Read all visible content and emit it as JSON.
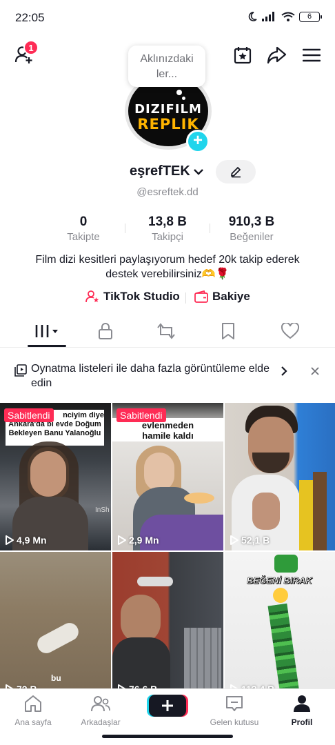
{
  "status_bar": {
    "time": "22:05",
    "battery": "6"
  },
  "profile": {
    "badge_count": "1",
    "note_text": "Aklınızdaki ler...",
    "avatar_line1": "DIZIFILM",
    "avatar_line2": "REPLIK",
    "username": "eşrefTEK",
    "handle": "@esreftek.dd",
    "stats": [
      {
        "value": "0",
        "label": "Takipte"
      },
      {
        "value": "13,8 B",
        "label": "Takipçi"
      },
      {
        "value": "910,3 B",
        "label": "Beğeniler"
      }
    ],
    "bio": "Film dizi kesitleri paylaşıyorum hedef 20k takip ederek destek verebilirsiniz🫶🌹",
    "tiktok_studio": "TikTok Studio",
    "balance": "Bakiye"
  },
  "banner": {
    "text": "Oynatma listeleri ile daha fazla görüntüleme elde edin"
  },
  "videos": [
    {
      "pinned": "Sabitlendi",
      "caption": "Ankara'da bi evde Doğum Bekleyen Banu Yalanoğlu",
      "caption_top": "nciyim diye",
      "views": "4,9 Mn",
      "watermark": "InSh"
    },
    {
      "pinned": "Sabitlendi",
      "caption": "evlenmeden hamile kaldı",
      "views": "2,9 Mn"
    },
    {
      "views": "52,1 B"
    },
    {
      "views": "72 B",
      "caption": "bu"
    },
    {
      "views": "76,6 B"
    },
    {
      "views": "113,4 B",
      "caption": "BEĞENİ BIRAK"
    }
  ],
  "bottom_nav": {
    "home": "Ana sayfa",
    "friends": "Arkadaşlar",
    "inbox": "Gelen kutusu",
    "profile": "Profil"
  },
  "colors": {
    "accent": "#fe2c55",
    "cyan": "#20d5ec",
    "text": "#161823",
    "muted": "#8a8b91"
  }
}
